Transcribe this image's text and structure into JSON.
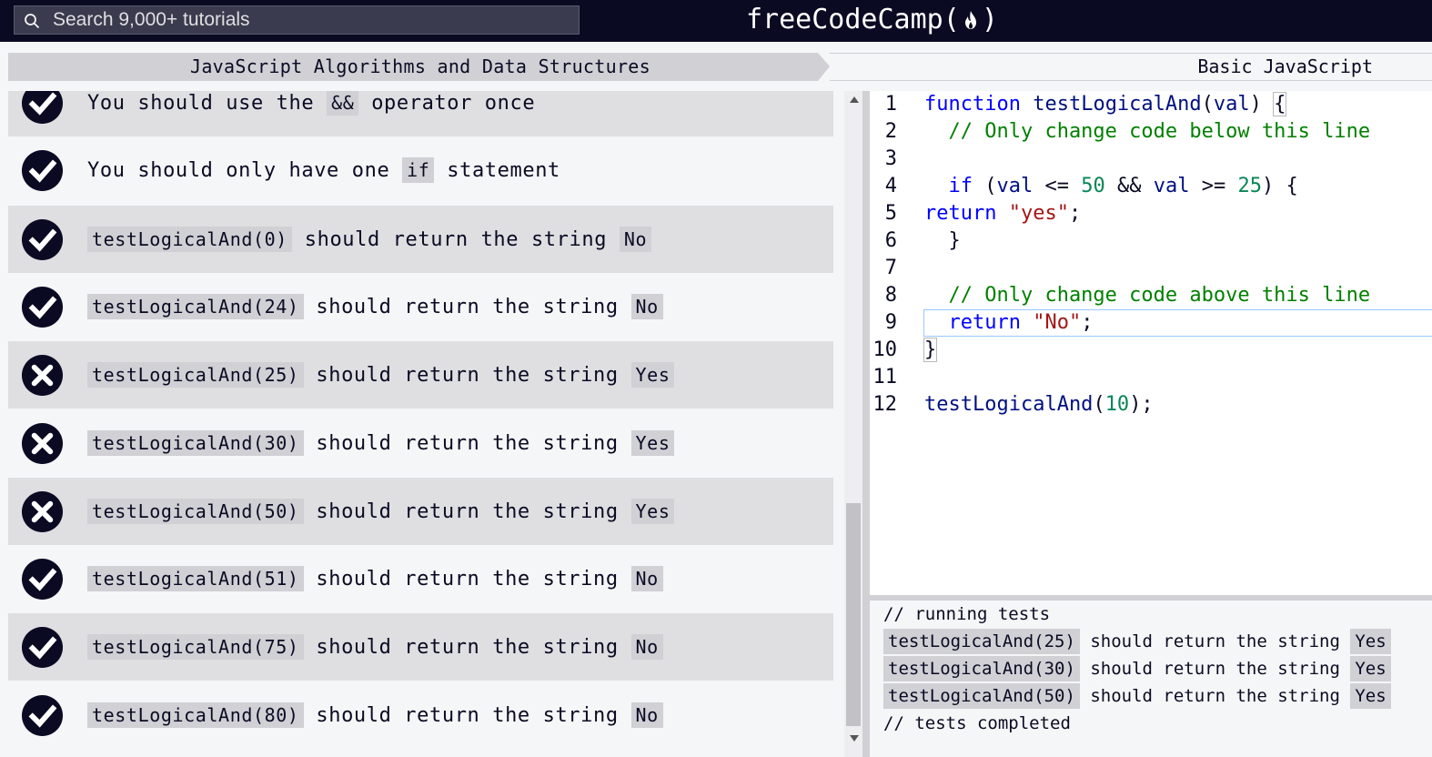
{
  "header": {
    "search_placeholder": "Search 9,000+ tutorials",
    "logo_text": "freeCodeCamp",
    "logo_open": "(",
    "logo_close": ")"
  },
  "breadcrumb": {
    "superblock": "JavaScript Algorithms and Data Structures",
    "block": "Basic JavaScript"
  },
  "tests": [
    {
      "status": "pass",
      "pre": "You should use the ",
      "code": "&&",
      "post": " operator once",
      "code2": ""
    },
    {
      "status": "pass",
      "pre": "You should only have one ",
      "code": "if",
      "post": " statement",
      "code2": ""
    },
    {
      "status": "pass",
      "pre": "",
      "code": "testLogicalAnd(0)",
      "post": " should return the string ",
      "code2": "No"
    },
    {
      "status": "pass",
      "pre": "",
      "code": "testLogicalAnd(24)",
      "post": " should return the string ",
      "code2": "No"
    },
    {
      "status": "fail",
      "pre": "",
      "code": "testLogicalAnd(25)",
      "post": " should return the string ",
      "code2": "Yes"
    },
    {
      "status": "fail",
      "pre": "",
      "code": "testLogicalAnd(30)",
      "post": " should return the string ",
      "code2": "Yes"
    },
    {
      "status": "fail",
      "pre": "",
      "code": "testLogicalAnd(50)",
      "post": " should return the string ",
      "code2": "Yes"
    },
    {
      "status": "pass",
      "pre": "",
      "code": "testLogicalAnd(51)",
      "post": " should return the string ",
      "code2": "No"
    },
    {
      "status": "pass",
      "pre": "",
      "code": "testLogicalAnd(75)",
      "post": " should return the string ",
      "code2": "No"
    },
    {
      "status": "pass",
      "pre": "",
      "code": "testLogicalAnd(80)",
      "post": " should return the string ",
      "code2": "No"
    }
  ],
  "editor": {
    "lines": [
      [
        {
          "t": "function",
          "c": "k"
        },
        {
          "t": " ",
          "c": "p"
        },
        {
          "t": "testLogicalAnd",
          "c": "f"
        },
        {
          "t": "(",
          "c": "p"
        },
        {
          "t": "val",
          "c": "f"
        },
        {
          "t": ") ",
          "c": "p"
        },
        {
          "t": "{",
          "c": "p bracket"
        }
      ],
      [
        {
          "t": "  // Only change code below this line",
          "c": "c"
        }
      ],
      [],
      [
        {
          "t": "  ",
          "c": "p"
        },
        {
          "t": "if",
          "c": "k"
        },
        {
          "t": " (",
          "c": "p"
        },
        {
          "t": "val",
          "c": "f"
        },
        {
          "t": " <= ",
          "c": "p"
        },
        {
          "t": "50",
          "c": "n"
        },
        {
          "t": " && ",
          "c": "p"
        },
        {
          "t": "val",
          "c": "f"
        },
        {
          "t": " >= ",
          "c": "p"
        },
        {
          "t": "25",
          "c": "n"
        },
        {
          "t": ") {",
          "c": "p"
        }
      ],
      [
        {
          "t": "return",
          "c": "k"
        },
        {
          "t": " ",
          "c": "p"
        },
        {
          "t": "\"yes\"",
          "c": "s"
        },
        {
          "t": ";",
          "c": "p"
        }
      ],
      [
        {
          "t": "  }",
          "c": "p"
        }
      ],
      [],
      [
        {
          "t": "  // Only change code above this line",
          "c": "c"
        }
      ],
      [
        {
          "t": "  ",
          "c": "p"
        },
        {
          "t": "return",
          "c": "k"
        },
        {
          "t": " ",
          "c": "p"
        },
        {
          "t": "\"No\"",
          "c": "s"
        },
        {
          "t": ";",
          "c": "p"
        }
      ],
      [
        {
          "t": "}",
          "c": "p bracket"
        }
      ],
      [],
      [
        {
          "t": "testLogicalAnd",
          "c": "f"
        },
        {
          "t": "(",
          "c": "p"
        },
        {
          "t": "10",
          "c": "n"
        },
        {
          "t": ");",
          "c": "p"
        }
      ]
    ],
    "active_line": 9
  },
  "console": {
    "start": "// running tests",
    "failures": [
      {
        "code": "testLogicalAnd(25)",
        "text": " should return the string ",
        "val": "Yes"
      },
      {
        "code": "testLogicalAnd(30)",
        "text": " should return the string ",
        "val": "Yes"
      },
      {
        "code": "testLogicalAnd(50)",
        "text": " should return the string ",
        "val": "Yes"
      }
    ],
    "end": "// tests completed"
  }
}
